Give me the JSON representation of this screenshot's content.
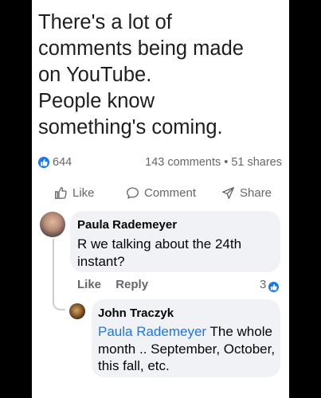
{
  "post": {
    "text": "There's a lot of\ncomments being made\non YouTube.\nPeople know\nsomething's coming."
  },
  "stats": {
    "like_count": "644",
    "comments": "143 comments",
    "separator": "•",
    "shares": "51 shares"
  },
  "actions": {
    "like": "Like",
    "comment": "Comment",
    "share": "Share"
  },
  "comments": [
    {
      "author": "Paula Rademeyer",
      "text": "R we talking about the 24th instant?",
      "like_label": "Like",
      "reply_label": "Reply",
      "reaction_count": "3"
    }
  ],
  "reply": {
    "author": "John Traczyk",
    "mention": "Paula Rademeyer",
    "text": " The whole month .. September, October, this fall, etc."
  },
  "colors": {
    "accent": "#1877f2",
    "bubble": "#f0f2f5",
    "muted": "#65676b"
  }
}
